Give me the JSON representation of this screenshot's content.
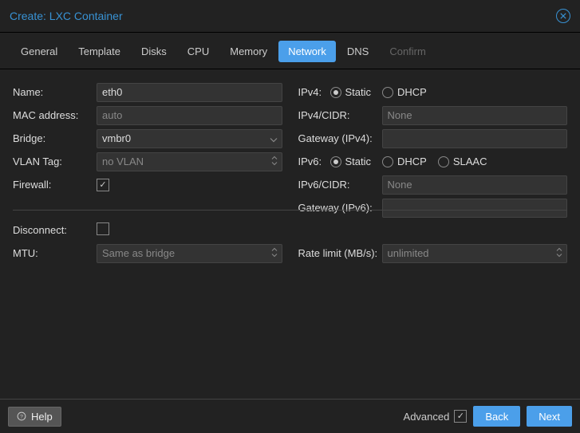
{
  "title": "Create: LXC Container",
  "tabs": {
    "general": "General",
    "template": "Template",
    "disks": "Disks",
    "cpu": "CPU",
    "memory": "Memory",
    "network": "Network",
    "dns": "DNS",
    "confirm": "Confirm"
  },
  "left": {
    "name_label": "Name:",
    "name_value": "eth0",
    "mac_label": "MAC address:",
    "mac_placeholder": "auto",
    "bridge_label": "Bridge:",
    "bridge_value": "vmbr0",
    "vlan_label": "VLAN Tag:",
    "vlan_placeholder": "no VLAN",
    "firewall_label": "Firewall:",
    "disconnect_label": "Disconnect:",
    "mtu_label": "MTU:",
    "mtu_placeholder": "Same as bridge"
  },
  "right": {
    "ipv4_label": "IPv4:",
    "ipv4_static": "Static",
    "ipv4_dhcp": "DHCP",
    "ipv4cidr_label": "IPv4/CIDR:",
    "ipv4cidr_placeholder": "None",
    "gw4_label": "Gateway (IPv4):",
    "ipv6_label": "IPv6:",
    "ipv6_static": "Static",
    "ipv6_dhcp": "DHCP",
    "ipv6_slaac": "SLAAC",
    "ipv6cidr_label": "IPv6/CIDR:",
    "ipv6cidr_placeholder": "None",
    "gw6_label": "Gateway (IPv6):",
    "rate_label": "Rate limit (MB/s):",
    "rate_placeholder": "unlimited"
  },
  "footer": {
    "help": "Help",
    "advanced": "Advanced",
    "back": "Back",
    "next": "Next"
  }
}
